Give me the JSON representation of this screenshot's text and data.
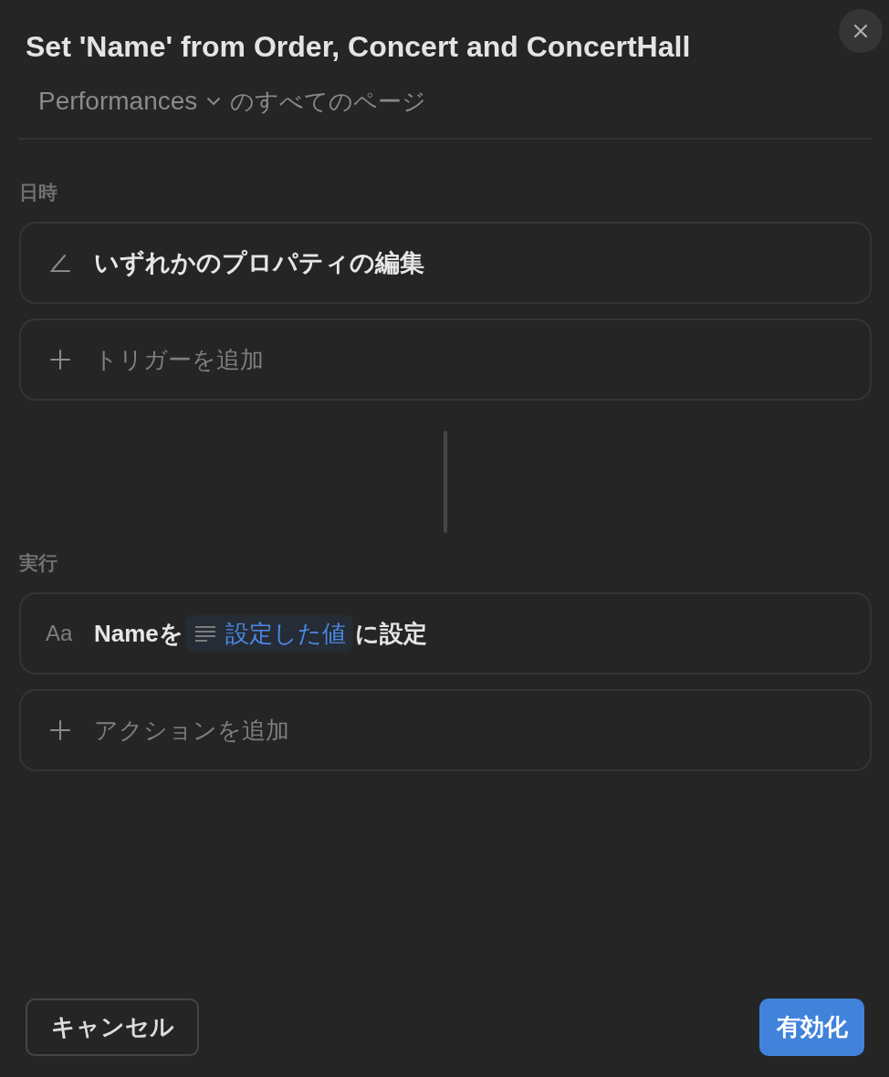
{
  "dialog": {
    "title": "Set 'Name' from Order, Concert and ConcertHall"
  },
  "scope": {
    "database": "Performances",
    "suffix": "のすべてのページ"
  },
  "sections": [
    {
      "label": "日時",
      "items": [
        {
          "kind": "trigger",
          "text": "いずれかのプロパティの編集"
        },
        {
          "kind": "add",
          "text": "トリガーを追加"
        }
      ]
    },
    {
      "label": "実行",
      "items": [
        {
          "kind": "action",
          "type_icon": "Aa",
          "prefix": "Nameを",
          "value": "設定した値",
          "suffix": "に設定"
        },
        {
          "kind": "add",
          "text": "アクションを追加"
        }
      ]
    }
  ],
  "buttons": [
    {
      "kind": "secondary",
      "label": "キャンセル"
    },
    {
      "kind": "primary",
      "label": "有効化"
    }
  ]
}
